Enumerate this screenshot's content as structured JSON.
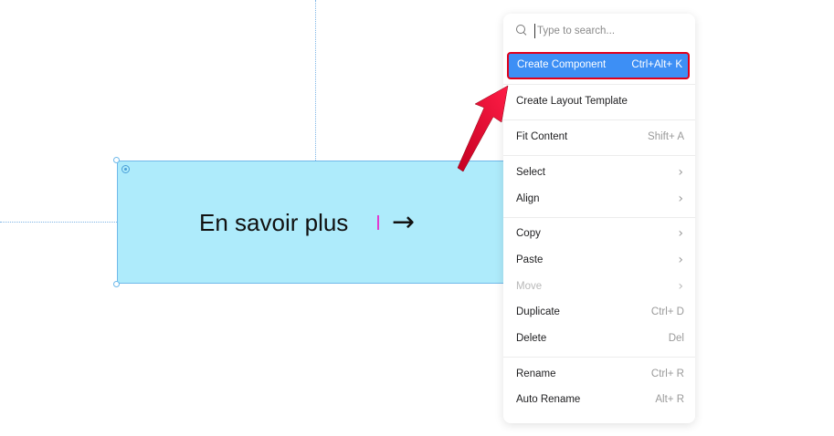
{
  "canvas": {
    "button_text": "En savoir plus",
    "button_arrow": "→"
  },
  "menu": {
    "search_placeholder": "Type to search...",
    "items": [
      {
        "label": "Create Component",
        "shortcut": "Ctrl+Alt+ K"
      },
      {
        "label": "Create Layout Template"
      },
      {
        "label": "Fit Content",
        "shortcut": "Shift+ A"
      },
      {
        "label": "Select",
        "chevron": "›"
      },
      {
        "label": "Align",
        "chevron": "›"
      },
      {
        "label": "Copy",
        "chevron": "›"
      },
      {
        "label": "Paste",
        "chevron": "›"
      },
      {
        "label": "Move",
        "chevron": "›"
      },
      {
        "label": "Duplicate",
        "shortcut": "Ctrl+ D"
      },
      {
        "label": "Delete",
        "shortcut": "Del"
      },
      {
        "label": "Rename",
        "shortcut": "Ctrl+ R"
      },
      {
        "label": "Auto Rename",
        "shortcut": "Alt+ R"
      }
    ]
  },
  "colors": {
    "frame_fill": "#aeebfb",
    "highlight_fill": "#3d8ff5",
    "annotation_red": "#e0001b"
  }
}
